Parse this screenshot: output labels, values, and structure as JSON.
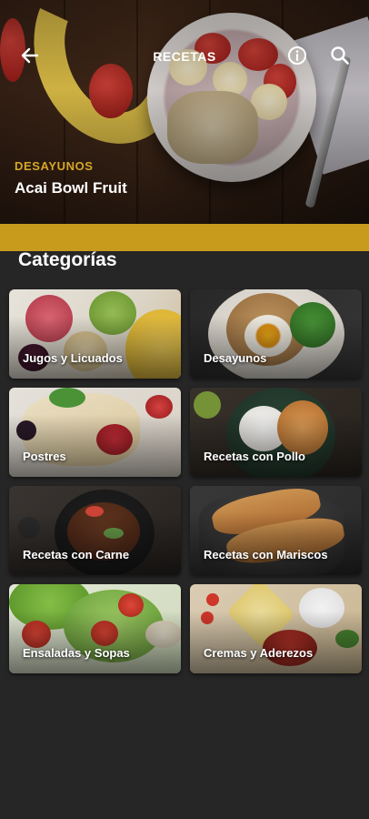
{
  "header": {
    "title": "RECETAS",
    "back_icon": "arrow-left-icon",
    "info_icon": "info-icon",
    "search_icon": "search-icon"
  },
  "featured": {
    "category": "DESAYUNOS",
    "name": "Acai Bowl Fruit"
  },
  "section": {
    "heading": "Categorías",
    "accent_color": "#c89b1c"
  },
  "categories": [
    {
      "label": "Jugos y Licuados"
    },
    {
      "label": "Desayunos"
    },
    {
      "label": "Postres"
    },
    {
      "label": "Recetas con Pollo"
    },
    {
      "label": "Recetas con Carne"
    },
    {
      "label": "Recetas con Mariscos"
    },
    {
      "label": "Ensaladas y Sopas"
    },
    {
      "label": "Cremas y Aderezos"
    }
  ],
  "colors": {
    "background": "#262626",
    "featured_category": "#d6a726"
  }
}
